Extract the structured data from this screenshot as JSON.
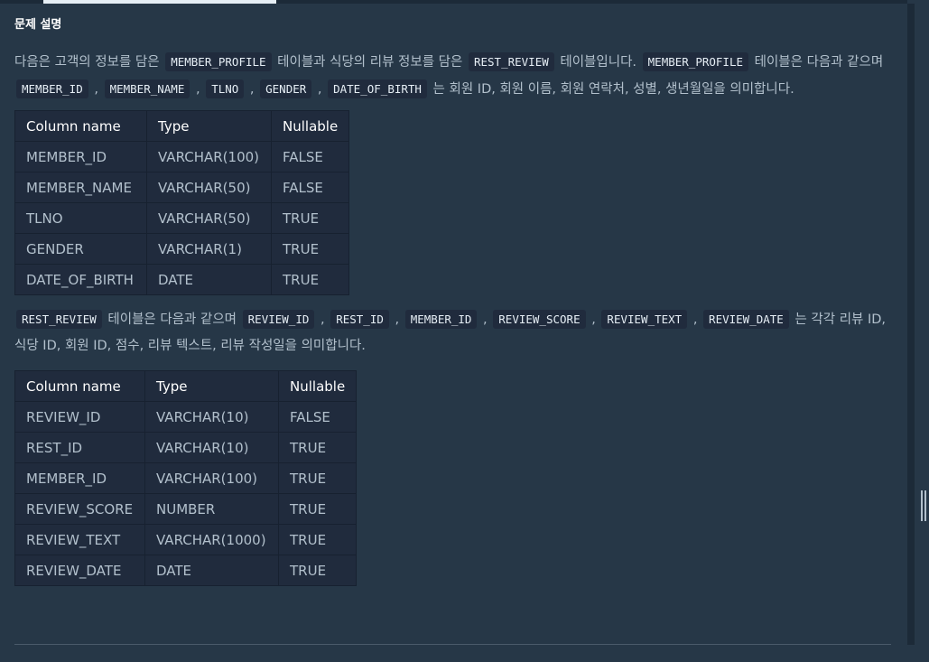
{
  "section_title": "문제 설명",
  "desc1": {
    "t1": "다음은 고객의 정보를 담은 ",
    "c1": "MEMBER_PROFILE",
    "t2": " 테이블과 식당의 리뷰 정보를 담은 ",
    "c2": "REST_REVIEW",
    "t3": " 테이블입니다. ",
    "c3": "MEMBER_PROFILE",
    "t4": " 테이블은 다음과 같으며 ",
    "c4": "MEMBER_ID",
    "s1": " , ",
    "c5": "MEMBER_NAME",
    "s2": " , ",
    "c6": "TLNO",
    "s3": " , ",
    "c7": "GENDER",
    "s4": " , ",
    "c8": "DATE_OF_BIRTH",
    "t5": " 는 회원 ID, 회원 이름, 회원 연락처, 성별, 생년월일을 의미합니다."
  },
  "table1": {
    "headers": [
      "Column name",
      "Type",
      "Nullable"
    ],
    "rows": [
      [
        "MEMBER_ID",
        "VARCHAR(100)",
        "FALSE"
      ],
      [
        "MEMBER_NAME",
        "VARCHAR(50)",
        "FALSE"
      ],
      [
        "TLNO",
        "VARCHAR(50)",
        "TRUE"
      ],
      [
        "GENDER",
        "VARCHAR(1)",
        "TRUE"
      ],
      [
        "DATE_OF_BIRTH",
        "DATE",
        "TRUE"
      ]
    ]
  },
  "desc2": {
    "c1": "REST_REVIEW",
    "t1": " 테이블은 다음과 같으며 ",
    "c2": "REVIEW_ID",
    "s1": " , ",
    "c3": "REST_ID",
    "s2": " , ",
    "c4": "MEMBER_ID",
    "s3": " , ",
    "c5": "REVIEW_SCORE",
    "s4": " , ",
    "c6": "REVIEW_TEXT",
    "s5": " , ",
    "c7": "REVIEW_DATE",
    "t2": " 는 각각 리뷰 ID, 식당 ID, 회원 ID, 점수, 리뷰 텍스트, 리뷰 작성일을 의미합니다."
  },
  "table2": {
    "headers": [
      "Column name",
      "Type",
      "Nullable"
    ],
    "rows": [
      [
        "REVIEW_ID",
        "VARCHAR(10)",
        "FALSE"
      ],
      [
        "REST_ID",
        "VARCHAR(10)",
        "TRUE"
      ],
      [
        "MEMBER_ID",
        "VARCHAR(100)",
        "TRUE"
      ],
      [
        "REVIEW_SCORE",
        "NUMBER",
        "TRUE"
      ],
      [
        "REVIEW_TEXT",
        "VARCHAR(1000)",
        "TRUE"
      ],
      [
        "REVIEW_DATE",
        "DATE",
        "TRUE"
      ]
    ]
  }
}
